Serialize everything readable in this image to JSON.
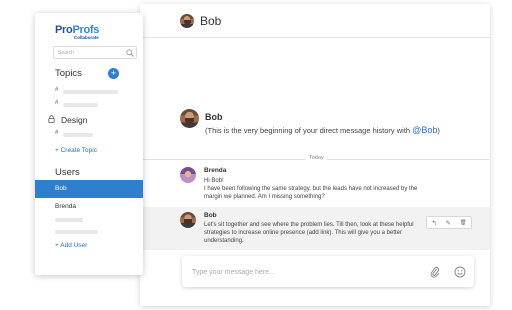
{
  "sidebar": {
    "logo": {
      "pro": "Pro",
      "profs": "Profs",
      "sub": "Collaborate"
    },
    "search_placeholder": "Search",
    "topics_title": "Topics",
    "add_topic_symbol": "+",
    "topic_hash": "#",
    "design_title": "Design",
    "design_hash": "#",
    "create_topic_label": "+ Create Topic",
    "users_title": "Users",
    "users": [
      {
        "name": "Bob",
        "active": true
      },
      {
        "name": "Brenda",
        "active": false
      }
    ],
    "add_user_label": "+ Add User"
  },
  "header": {
    "title": "Bob"
  },
  "intro": {
    "name": "Bob",
    "text": "(This is the very beginning of your direct message history with ",
    "mention": "@Bob",
    "text_end": ")"
  },
  "divider_label": "Today",
  "messages": [
    {
      "author": "Brenda",
      "lines": [
        "Hi Bob!",
        "I have been following the same strategy, but the leads have not increased by the",
        "margin we planned. Am I missing something?"
      ]
    },
    {
      "author": "Bob",
      "lines": [
        "Let's sit together and see where the problem lies. Till then, look at these helpful",
        "strategies to increase online presence (add link). This will give you a better",
        "understanding."
      ]
    }
  ],
  "message_actions": {
    "reply": "↰",
    "edit": "✎",
    "delete": "🗑"
  },
  "composer": {
    "placeholder": "Type your message here..."
  },
  "colors": {
    "accent": "#2f7fcf",
    "logo_dark": "#2a4f8f",
    "link": "#2e6fbf"
  }
}
